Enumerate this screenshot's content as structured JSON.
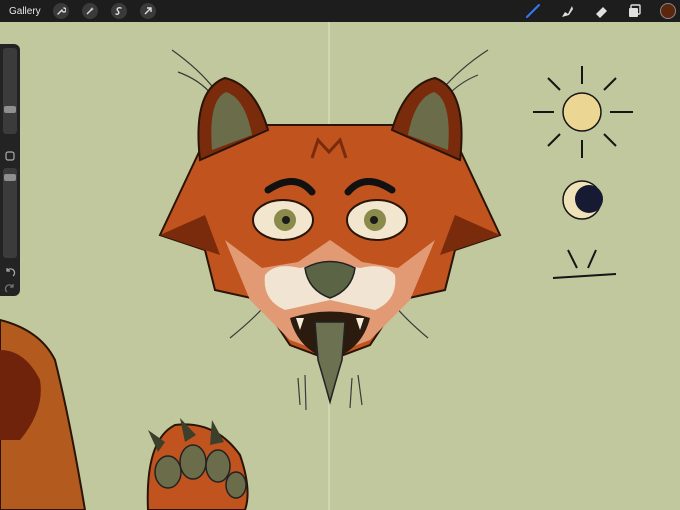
{
  "toolbar": {
    "gallery_label": "Gallery",
    "left_tools": [
      "wrench-icon",
      "magic-wand-icon",
      "selection-icon",
      "transform-arrow-icon"
    ],
    "right_tools": [
      "brush-icon",
      "smudge-icon",
      "eraser-icon",
      "layers-icon"
    ],
    "active_tool": "brush-icon",
    "active_color": "#5b260e",
    "accent_color": "#2f7cf6"
  },
  "sidebar": {
    "brush_size_level": 0.62,
    "opacity_level": 0.22,
    "buttons": [
      "modify-square-icon",
      "undo-icon",
      "redo-icon"
    ]
  },
  "canvas": {
    "background_color": "#c1c89d",
    "symmetry_guide": "vertical"
  }
}
